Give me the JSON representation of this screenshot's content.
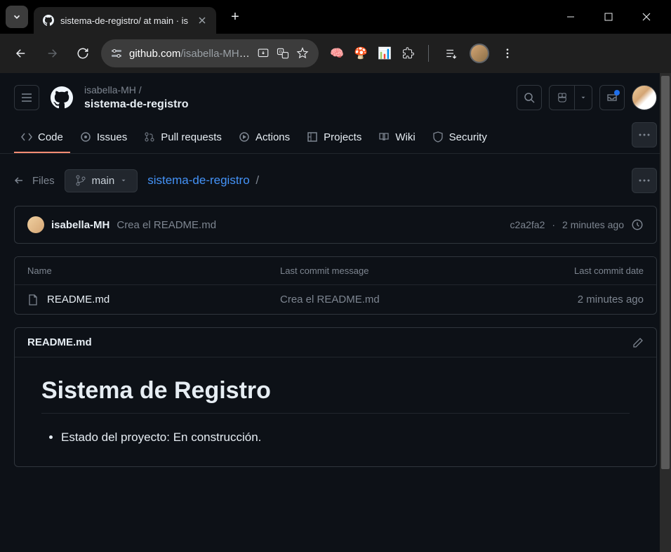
{
  "browser": {
    "tab_title": "sistema-de-registro/ at main · is",
    "url_domain": "github.com",
    "url_path": "/isabella-MH/sistema-...",
    "extensions": [
      "🧠",
      "🍄",
      "📊",
      "🧩"
    ]
  },
  "repo": {
    "owner": "isabella-MH",
    "owner_suffix": " /",
    "name": "sistema-de-registro"
  },
  "nav": {
    "code": "Code",
    "issues": "Issues",
    "pulls": "Pull requests",
    "actions": "Actions",
    "projects": "Projects",
    "wiki": "Wiki",
    "security": "Security"
  },
  "content": {
    "files_label": "Files",
    "branch": "main",
    "breadcrumb_root": "sistema-de-registro",
    "breadcrumb_sep": "/"
  },
  "commit": {
    "author": "isabella-MH",
    "message": "Crea el README.md",
    "sha": "c2a2fa2",
    "sep": " · ",
    "time": "2 minutes ago"
  },
  "table": {
    "col_name": "Name",
    "col_msg": "Last commit message",
    "col_date": "Last commit date",
    "rows": [
      {
        "name": "README.md",
        "msg": "Crea el README.md",
        "date": "2 minutes ago"
      }
    ]
  },
  "readme": {
    "filename": "README.md",
    "heading": "Sistema de Registro",
    "bullet1": "Estado del proyecto: En construcción."
  }
}
